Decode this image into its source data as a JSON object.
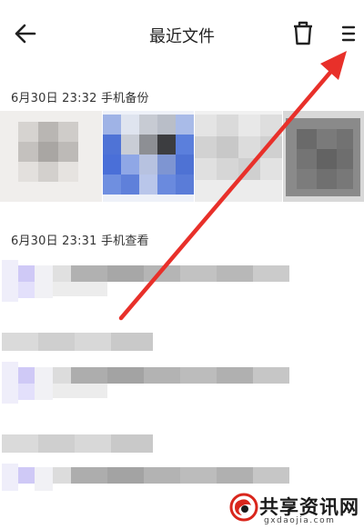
{
  "header": {
    "title": "最近文件",
    "back_icon": "arrow-left-icon",
    "delete_icon": "trash-icon",
    "menu_icon": "menu-icon"
  },
  "groups": [
    {
      "label": "6月30日 23:32  手机备份"
    },
    {
      "label": "6月30日 23:31  手机查看"
    }
  ],
  "annotation": {
    "color": "#e8302a"
  },
  "watermark": {
    "text": "共享资讯网",
    "sub": "gxdaojia.com"
  }
}
